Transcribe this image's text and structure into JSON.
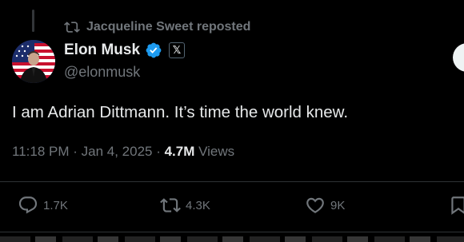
{
  "repost": {
    "label": "Jacqueline Sweet reposted",
    "icon": "repost-icon"
  },
  "author": {
    "name": "Elon Musk",
    "handle": "@elonmusk",
    "verified_icon": "verified-badge-icon",
    "affiliation_badge": "𝕏",
    "verified_color": "#1d9bf0"
  },
  "tweet": {
    "text": "I am Adrian Dittmann. It’s time the world knew."
  },
  "meta": {
    "time": "11:18 PM",
    "separator": " · ",
    "date": "Jan 4, 2025",
    "views_count": "4.7M",
    "views_label": "Views"
  },
  "actions": {
    "replies": "1.7K",
    "reposts": "4.3K",
    "likes": "9K"
  },
  "colors": {
    "background": "#000000",
    "primary_text": "#e7e9ea",
    "secondary_text": "#71767b",
    "divider": "#2f3336"
  }
}
